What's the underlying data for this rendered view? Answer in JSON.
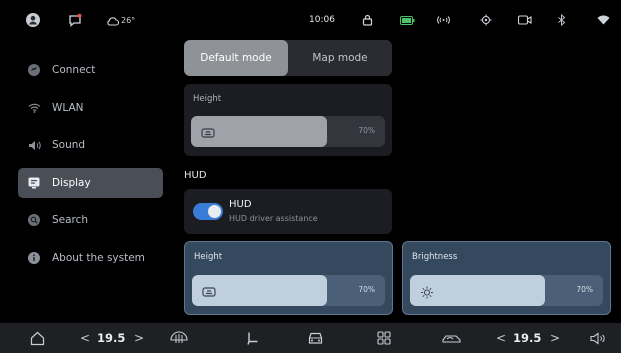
{
  "status_bar": {
    "time": "10:06",
    "weather_temp": "26°"
  },
  "sidebar": {
    "items": [
      {
        "label": "Connect",
        "icon": "connect-icon",
        "active": false
      },
      {
        "label": "WLAN",
        "icon": "wifi-icon",
        "active": false
      },
      {
        "label": "Sound",
        "icon": "speaker-icon",
        "active": false
      },
      {
        "label": "Display",
        "icon": "display-icon",
        "active": true
      },
      {
        "label": "Search",
        "icon": "search-icon",
        "active": false
      },
      {
        "label": "About the system",
        "icon": "info-icon",
        "active": false
      }
    ]
  },
  "mode_selector": {
    "options": [
      "Default mode",
      "Map mode"
    ],
    "selected": "Default mode"
  },
  "height_card": {
    "title": "Height",
    "value_text": "70%",
    "value": 0.7
  },
  "hud_section": {
    "label": "HUD",
    "toggle_title": "HUD",
    "toggle_subtitle": "HUD driver assistance",
    "enabled": true
  },
  "hud_height": {
    "title": "Height",
    "value_text": "70%",
    "value": 0.7
  },
  "hud_brightness": {
    "title": "Brightness",
    "value_text": "70%",
    "value": 0.7
  },
  "bottom_bar": {
    "left_temp": "19.5",
    "right_temp": "19.5",
    "prev": "<",
    "next": ">"
  },
  "colors": {
    "accent": "#3a7bd5",
    "selected_card": "#34495e"
  }
}
